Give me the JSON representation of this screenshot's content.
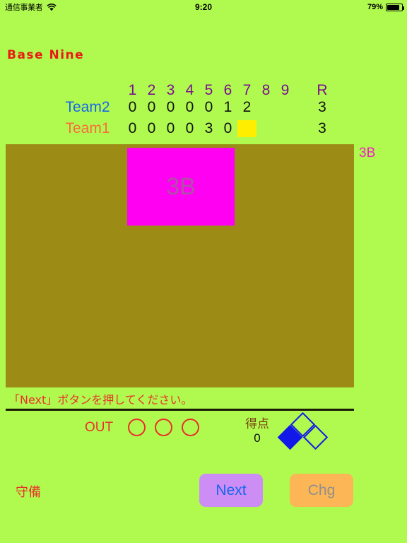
{
  "statusbar": {
    "carrier": "通信事業者",
    "wifi_icon": "wifi-icon",
    "time": "9:20",
    "battery_percent": "79%",
    "battery_icon": "battery-icon"
  },
  "app": {
    "title": "Base Nine",
    "title_color": "#e81b14",
    "background_color": "#b0fa50"
  },
  "scoreboard": {
    "inning_headers": [
      "1",
      "2",
      "3",
      "4",
      "5",
      "6",
      "7",
      "8",
      "9"
    ],
    "runs_header": "R",
    "header_color": "#7a0f8c",
    "rows": [
      {
        "team": "Team2",
        "team_color": "#1767e8",
        "innings": [
          "0",
          "0",
          "0",
          "0",
          "0",
          "1",
          "2",
          "",
          ""
        ],
        "runs": "3",
        "highlight_index": -1
      },
      {
        "team": "Team1",
        "team_color": "#fb6d3a",
        "innings": [
          "0",
          "0",
          "0",
          "0",
          "3",
          "0",
          "",
          "",
          ""
        ],
        "runs": "3",
        "highlight_index": 6
      }
    ],
    "highlight_color": "#ffee00"
  },
  "field": {
    "background_color": "#9c8b15",
    "play_card": {
      "label": "3B",
      "background_color": "#ff00f2",
      "text_color": "#b050a8"
    },
    "side_label": "3B",
    "side_label_color": "#ee1fc0"
  },
  "message": {
    "text": "「Next」ボタンを押してください。",
    "color": "#e8322a"
  },
  "out": {
    "label": "OUT",
    "count": 0,
    "total": 3,
    "color": "#e8322a"
  },
  "score": {
    "label": "得点",
    "value": "0",
    "label_color": "#7a4310"
  },
  "bases": {
    "first_occupied": false,
    "second_occupied": false,
    "third_occupied": true,
    "color": "#1218e8"
  },
  "controls": {
    "defense_label": "守備",
    "defense_color": "#e8322a",
    "next_label": "Next",
    "next_bg": "#cc8ef5",
    "next_fg": "#1565f0",
    "chg_label": "Chg",
    "chg_bg": "#fcb655",
    "chg_fg": "#8f8f8f"
  }
}
